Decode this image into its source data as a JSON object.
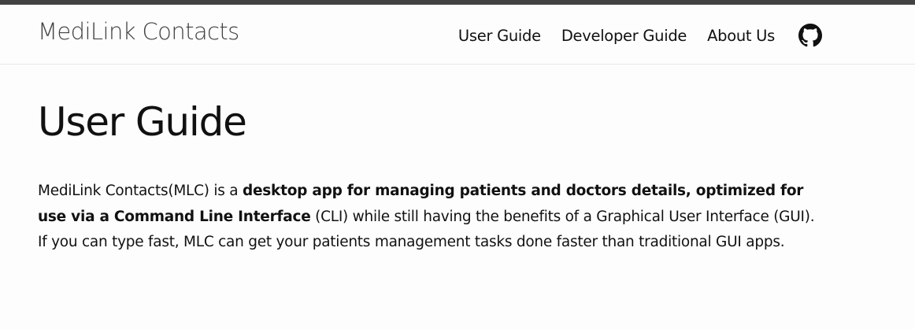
{
  "header": {
    "site_title": "MediLink Contacts",
    "nav": [
      {
        "label": "User Guide"
      },
      {
        "label": "Developer Guide"
      },
      {
        "label": "About Us"
      }
    ],
    "github_icon": "github-icon"
  },
  "main": {
    "title": "User Guide",
    "intro": {
      "part1": "MediLink Contacts(MLC) is a ",
      "bold1": "desktop app for managing patients and doctors details, optimized for use via a Command Line Interface",
      "part2": " (CLI) while still having the benefits of a Graphical User Interface (GUI). If you can type fast, MLC can get your patients management tasks done faster than traditional GUI apps."
    }
  },
  "colors": {
    "top_strip": "#424242",
    "site_title": "#424242",
    "text": "#111111",
    "background": "#fdfdfd"
  }
}
